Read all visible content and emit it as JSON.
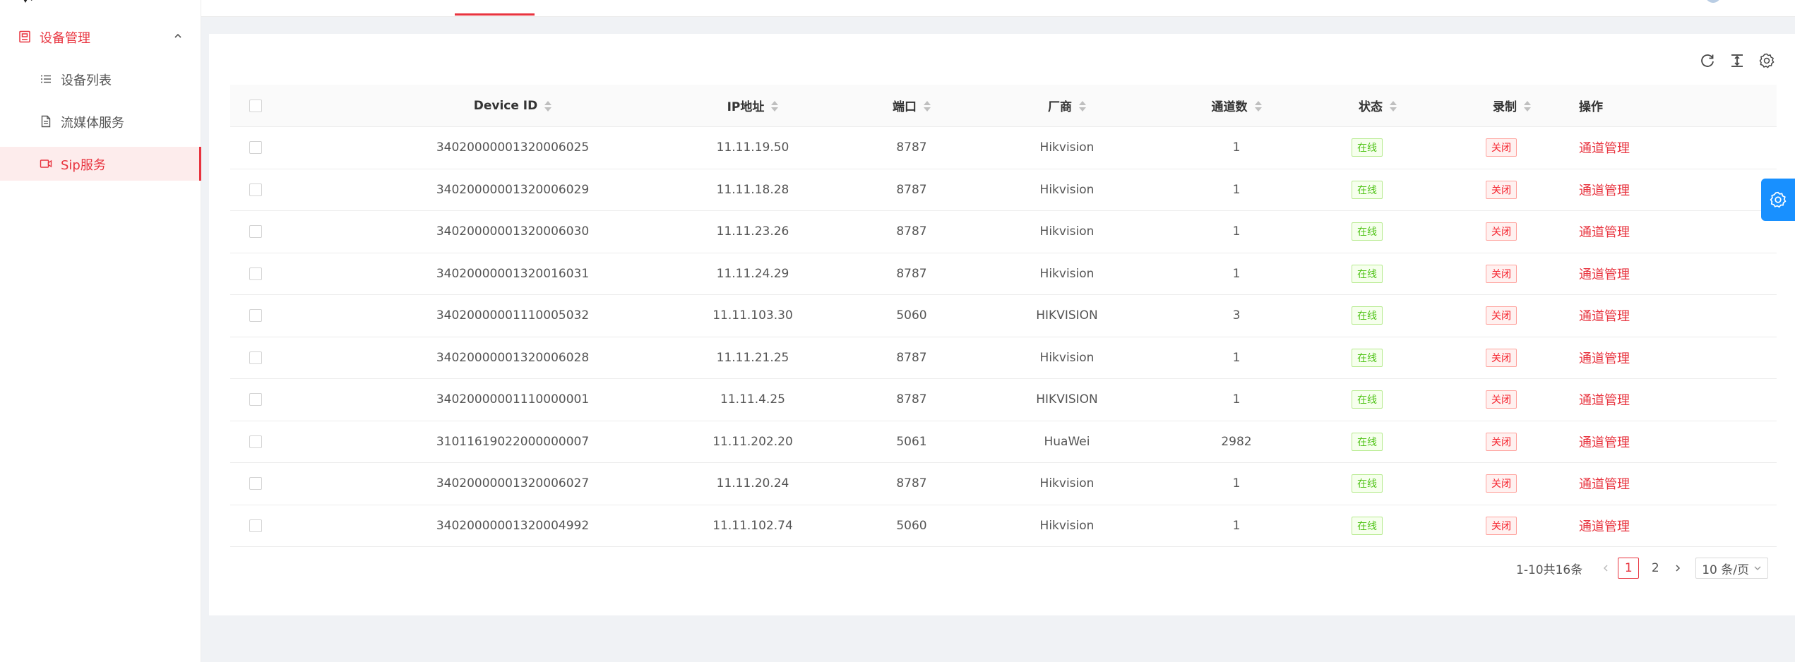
{
  "sidebar": {
    "group_label": "设备管理",
    "items": [
      {
        "label": "设备列表",
        "active": false
      },
      {
        "label": "流媒体服务",
        "active": false
      },
      {
        "label": "Sip服务",
        "active": true
      }
    ]
  },
  "colors": {
    "accent": "#e8343f",
    "online": "#52c41a",
    "float_button": "#1890ff"
  },
  "table": {
    "headers": {
      "device_id": "Device ID",
      "ip": "IP地址",
      "port": "端口",
      "vendor": "厂商",
      "channels": "通道数",
      "status": "状态",
      "record": "录制",
      "actions": "操作"
    },
    "rows": [
      {
        "device_id": "34020000001320006025",
        "ip": "11.11.19.50",
        "port": "8787",
        "vendor": "Hikvision",
        "channels": "1",
        "status": "在线",
        "record": "关闭",
        "action": "通道管理"
      },
      {
        "device_id": "34020000001320006029",
        "ip": "11.11.18.28",
        "port": "8787",
        "vendor": "Hikvision",
        "channels": "1",
        "status": "在线",
        "record": "关闭",
        "action": "通道管理"
      },
      {
        "device_id": "34020000001320006030",
        "ip": "11.11.23.26",
        "port": "8787",
        "vendor": "Hikvision",
        "channels": "1",
        "status": "在线",
        "record": "关闭",
        "action": "通道管理"
      },
      {
        "device_id": "34020000001320016031",
        "ip": "11.11.24.29",
        "port": "8787",
        "vendor": "Hikvision",
        "channels": "1",
        "status": "在线",
        "record": "关闭",
        "action": "通道管理"
      },
      {
        "device_id": "34020000001110005032",
        "ip": "11.11.103.30",
        "port": "5060",
        "vendor": "HIKVISION",
        "channels": "3",
        "status": "在线",
        "record": "关闭",
        "action": "通道管理"
      },
      {
        "device_id": "34020000001320006028",
        "ip": "11.11.21.25",
        "port": "8787",
        "vendor": "Hikvision",
        "channels": "1",
        "status": "在线",
        "record": "关闭",
        "action": "通道管理"
      },
      {
        "device_id": "34020000001110000001",
        "ip": "11.11.4.25",
        "port": "8787",
        "vendor": "HIKVISION",
        "channels": "1",
        "status": "在线",
        "record": "关闭",
        "action": "通道管理"
      },
      {
        "device_id": "31011619022000000007",
        "ip": "11.11.202.20",
        "port": "5061",
        "vendor": "HuaWei",
        "channels": "2982",
        "status": "在线",
        "record": "关闭",
        "action": "通道管理"
      },
      {
        "device_id": "34020000001320006027",
        "ip": "11.11.20.24",
        "port": "8787",
        "vendor": "Hikvision",
        "channels": "1",
        "status": "在线",
        "record": "关闭",
        "action": "通道管理"
      },
      {
        "device_id": "34020000001320004992",
        "ip": "11.11.102.74",
        "port": "5060",
        "vendor": "Hikvision",
        "channels": "1",
        "status": "在线",
        "record": "关闭",
        "action": "通道管理"
      }
    ]
  },
  "pagination": {
    "total_text": "1-10共16条",
    "pages": [
      "1",
      "2"
    ],
    "current": "1",
    "page_size": "10 条/页"
  }
}
